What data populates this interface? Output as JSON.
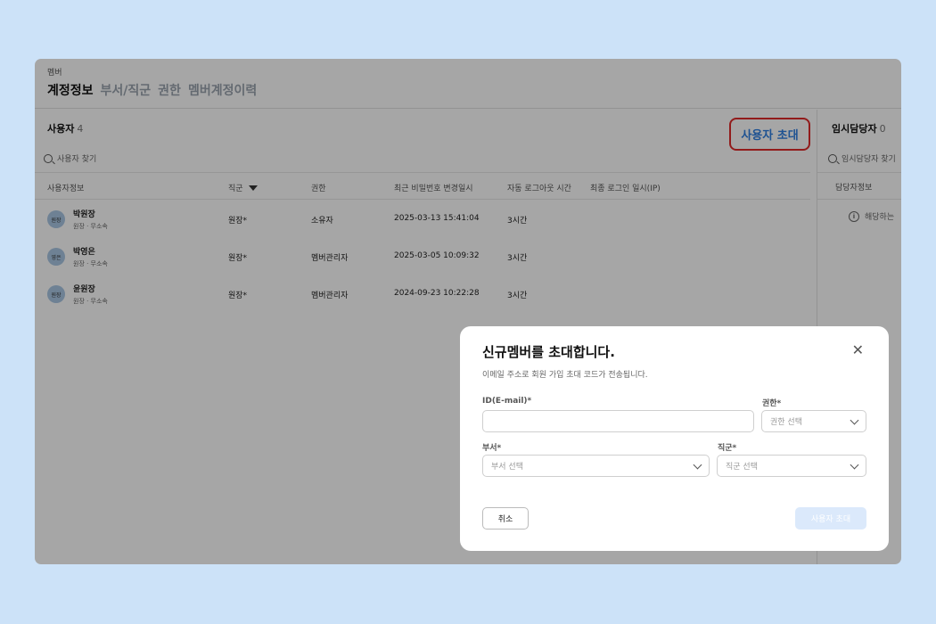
{
  "header": {
    "breadcrumb": "멤버",
    "tabs": [
      "계정정보",
      "부서/직군",
      "권한",
      "멤버계정이력"
    ]
  },
  "users": {
    "title": "사용자",
    "count": "4",
    "invite_button": "사용자 초대",
    "search_placeholder": "사용자 찾기",
    "columns": [
      "사용자정보",
      "직군",
      "권한",
      "최근 비밀번호 변경일시",
      "자동 로그아웃 시간",
      "최종 로그인 일시(IP)"
    ],
    "rows": [
      {
        "avatar": "원장",
        "name": "박원장",
        "sub": "원장 · 무소속",
        "group": "원장*",
        "role": "소유자",
        "pw_changed": "2025-03-13 15:41:04",
        "logout": "3시간"
      },
      {
        "avatar": "영은",
        "name": "박영은",
        "sub": "원장 · 무소속",
        "group": "원장*",
        "role": "멤버관리자",
        "pw_changed": "2025-03-05 10:09:32",
        "logout": "3시간"
      },
      {
        "avatar": "원장",
        "name": "윤원장",
        "sub": "원장 · 무소속",
        "group": "원장*",
        "role": "멤버관리자",
        "pw_changed": "2024-09-23 10:22:28",
        "logout": "3시간"
      }
    ]
  },
  "temp": {
    "title": "임시담당자",
    "count": "0",
    "search_placeholder": "임시담당자 찾기",
    "column": "담당자정보",
    "empty": "해당하는"
  },
  "modal": {
    "title": "신규멤버를 초대합니다.",
    "subtitle": "이메일 주소로 회원 가입 초대 코드가 전송됩니다.",
    "id_label": "ID(E-mail)*",
    "id_value": "",
    "role_label": "권한*",
    "role_placeholder": "권한 선택",
    "dept_label": "부서*",
    "dept_placeholder": "부서 선택",
    "group_label": "직군*",
    "group_placeholder": "직군 선택",
    "cancel": "취소",
    "submit": "사용자 초대"
  }
}
